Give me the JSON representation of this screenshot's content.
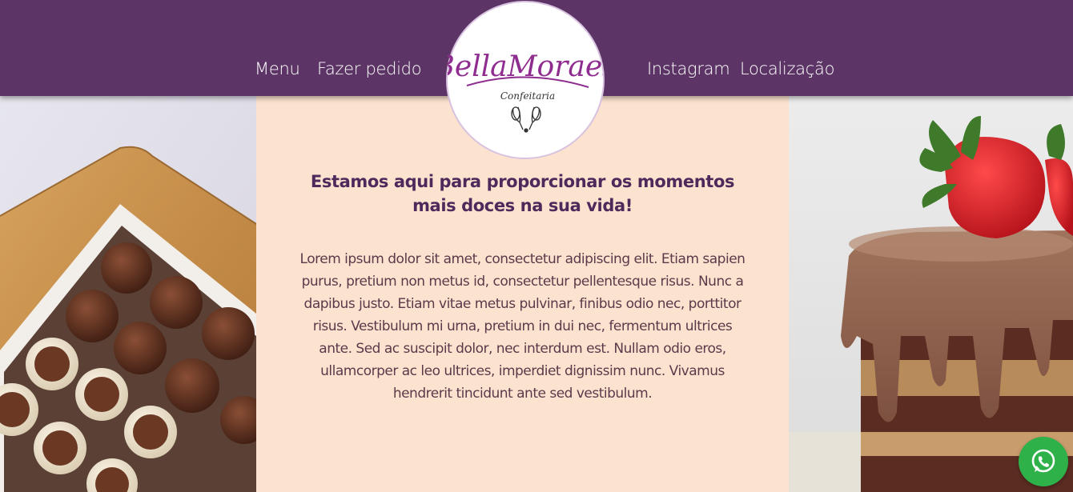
{
  "nav": {
    "menu": "Menu",
    "order": "Fazer pedido",
    "instagram": "Instagram",
    "location": "Localização"
  },
  "logo": {
    "name": "BellaMoraes",
    "subtitle": "Confeitaria"
  },
  "main": {
    "headline": "Estamos aqui para proporcionar os momentos mais doces na sua vida!",
    "body": "Lorem ipsum dolor sit amet, consectetur adipiscing elit. Etiam sapien purus, pretium non metus id, consectetur pellentesque risus. Nunc a dapibus justo. Etiam vitae metus pulvinar, finibus odio nec, porttitor risus. Vestibulum mi urna, pretium in dui nec, fermentum ultrices ante. Sed ac suscipit dolor, nec interdum est. Nullam odio eros, ullamcorper ac leo ultrices, imperdiet dignissim nunc. Vivamus hendrerit tincidunt ante sed vestibulum."
  },
  "images": {
    "left": "brigadeiros-box-photo",
    "right": "chocolate-strawberry-cake-photo"
  },
  "icons": {
    "whatsapp": "whatsapp-icon",
    "whisk": "whisk-icon"
  },
  "colors": {
    "header": "#5c3566",
    "content_bg": "#fbe3cf",
    "headline": "#4e2a5c",
    "logo_text": "#8e2d8f",
    "whatsapp": "#2fb14a"
  }
}
